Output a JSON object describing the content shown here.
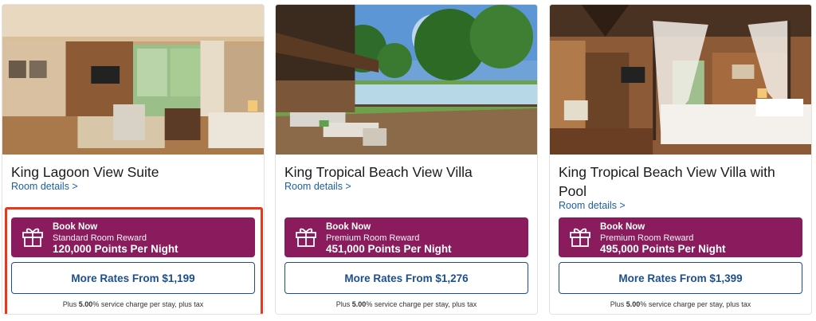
{
  "rooms": [
    {
      "title": "King Lagoon View Suite",
      "details_link": "Room details >",
      "photo": "suite-interior-photo",
      "book_now": "Book Now",
      "reward_type": "Standard Room Reward",
      "points": "120,000 Points Per Night",
      "more_rates": "More Rates From $1,199",
      "fee_prefix": "Plus ",
      "fee_percent": "5.00",
      "fee_suffix": "% service charge per stay, plus tax",
      "selected": true
    },
    {
      "title": "King Tropical Beach View Villa",
      "details_link": "Room details >",
      "photo": "villa-deck-photo",
      "book_now": "Book Now",
      "reward_type": "Premium Room Reward",
      "points": "451,000 Points Per Night",
      "more_rates": "More Rates From $1,276",
      "fee_prefix": "Plus ",
      "fee_percent": "5.00",
      "fee_suffix": "% service charge per stay, plus tax",
      "selected": false
    },
    {
      "title": "King Tropical Beach View Villa with Pool",
      "details_link": "Room details >",
      "photo": "villa-bedroom-photo",
      "book_now": "Book Now",
      "reward_type": "Premium Room Reward",
      "points": "495,000 Points Per Night",
      "more_rates": "More Rates From $1,399",
      "fee_prefix": "Plus ",
      "fee_percent": "5.00",
      "fee_suffix": "% service charge per stay, plus tax",
      "selected": false
    }
  ],
  "colors": {
    "book_button": "#8a1c5e",
    "more_rates_border": "#1c4f8f",
    "link": "#1b5fa8",
    "selection_outline": "#e8381c"
  },
  "icons": {
    "reward": "gift-icon"
  }
}
